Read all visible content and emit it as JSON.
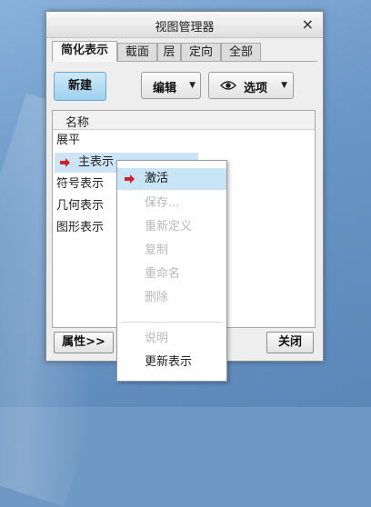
{
  "dialog": {
    "title": "视图管理器",
    "close_label": "×",
    "tabs": [
      {
        "label": "简化表示",
        "active": true
      },
      {
        "label": "截面"
      },
      {
        "label": "层"
      },
      {
        "label": "定向"
      },
      {
        "label": "全部"
      }
    ],
    "toolbar": {
      "new_label": "新建",
      "edit_label": "编辑",
      "options_label": "选项",
      "dropdown_glyph": "▼"
    },
    "list": {
      "header": "名称",
      "items": [
        {
          "label": "展平"
        },
        {
          "label": "主表示",
          "selected": true
        },
        {
          "label": "符号表示"
        },
        {
          "label": "几何表示"
        },
        {
          "label": "图形表示"
        }
      ]
    },
    "footer": {
      "properties_label": "属性>>",
      "close_label": "关闭"
    }
  },
  "context_menu": {
    "items": [
      {
        "label": "激活",
        "state": "active"
      },
      {
        "label": "保存...",
        "state": "disabled"
      },
      {
        "label": "重新定义",
        "state": "disabled"
      },
      {
        "label": "复制",
        "state": "disabled"
      },
      {
        "label": "重命名",
        "state": "disabled"
      },
      {
        "label": "删除",
        "state": "disabled"
      },
      {
        "label": "说明",
        "state": "disabled"
      },
      {
        "label": "更新表示",
        "state": "enabled"
      }
    ]
  },
  "colors": {
    "arrow_red": "#d0202a",
    "selection_blue": "#cde4f7",
    "new_button_blue": "#9fd0ef"
  }
}
